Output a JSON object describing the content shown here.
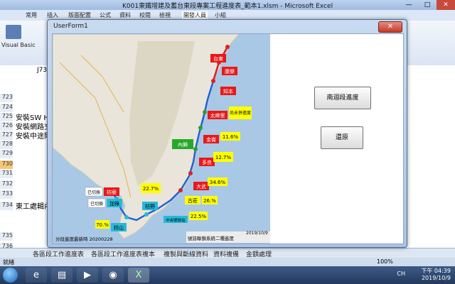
{
  "excel": {
    "title": "K001東鐵增建及蓄台東段專案工程進度表_範本1.xlsm - Microsoft Excel",
    "tabs": [
      "常用",
      "插入",
      "版面配置",
      "公式",
      "資料",
      "校閱",
      "檢視",
      "開發人員",
      "小組"
    ],
    "ribbon_item": "Visual Basic",
    "name_box": "J730",
    "rows": [
      {
        "num": "723",
        "text": ""
      },
      {
        "num": "724",
        "text": ""
      },
      {
        "num": "725",
        "text": "安裝SW HU"
      },
      {
        "num": "726",
        "text": "安裝網路交"
      },
      {
        "num": "727",
        "text": "安裝中途閘"
      },
      {
        "num": "728",
        "text": ""
      },
      {
        "num": "729",
        "text": ""
      },
      {
        "num": "730",
        "text": ""
      },
      {
        "num": "731",
        "text": ""
      },
      {
        "num": "732",
        "text": ""
      },
      {
        "num": "733",
        "text": ""
      },
      {
        "num": "734",
        "text": "東工處輯內"
      },
      {
        "num": "735",
        "text": ""
      },
      {
        "num": "736",
        "text": ""
      },
      {
        "num": "737",
        "text": ""
      }
    ],
    "sheet_tabs": [
      "各區段工作進度表",
      "各區段工作進度表複本",
      "複製與斷線資料",
      "資料複備",
      "金額處理"
    ],
    "status": "就緒",
    "zoom": "100%"
  },
  "taskbar": {
    "lang": "CH",
    "time": "下午 04:39",
    "date": "2019/10/9"
  },
  "userform": {
    "title": "UserForm1",
    "close_label": "✕",
    "btn_progress": "南迴段進度",
    "btn_restore": "還原",
    "map": {
      "stations": {
        "zhiben": "知本",
        "taimali": "太麻里",
        "jinlun": "金崙",
        "dawu": "大武",
        "guzhuang": "古莊",
        "fangye": "枋野",
        "zhongyang": "中央號誌站",
        "fangshan": "枋山",
        "fangliao": "枋寮",
        "jialu": "加祿",
        "neishi": "內獅",
        "duoliang": "多良",
        "kangle": "康樂",
        "taidong": "台東"
      },
      "chinese_labels": {
        "jialu_done": "已切換",
        "fangliao_done": "已切換",
        "taimali_note": "尚未併進度"
      },
      "percents": {
        "jinlun": "11.6%",
        "duoliang": "12.7%",
        "dawu": "34.6%",
        "guzhuang": "26.%",
        "fangye": "22.7%",
        "zhongyang": "22.5%",
        "fangshan": "70.%"
      },
      "footer_left": "分段進度最新時 20200228",
      "footer_right": "號誌聯鎖系統二種進度",
      "date": "2019/10/9"
    }
  }
}
